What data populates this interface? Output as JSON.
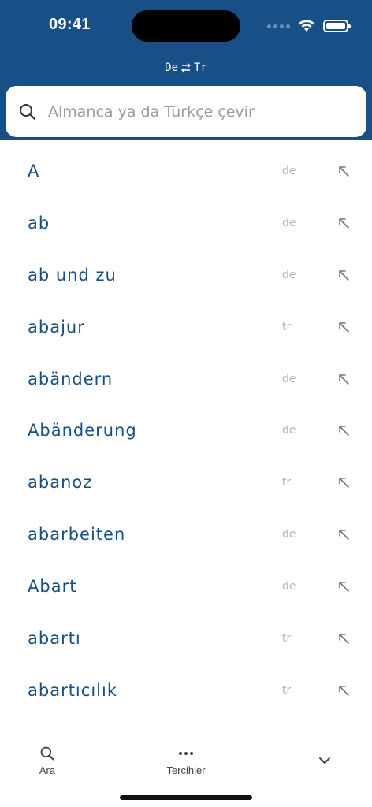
{
  "status": {
    "time": "09:41"
  },
  "header": {
    "lang_left": "De",
    "lang_right": "Tr"
  },
  "search": {
    "placeholder": "Almanca ya da Türkçe çevir",
    "value": ""
  },
  "results": [
    {
      "word": "A",
      "lang": "de"
    },
    {
      "word": "ab",
      "lang": "de"
    },
    {
      "word": "ab und zu",
      "lang": "de"
    },
    {
      "word": "abajur",
      "lang": "tr"
    },
    {
      "word": "abändern",
      "lang": "de"
    },
    {
      "word": "Abänderung",
      "lang": "de"
    },
    {
      "word": "abanoz",
      "lang": "tr"
    },
    {
      "word": "abarbeiten",
      "lang": "de"
    },
    {
      "word": "Abart",
      "lang": "de"
    },
    {
      "word": "abartı",
      "lang": "tr"
    },
    {
      "word": "abartıcılık",
      "lang": "tr"
    }
  ],
  "tabbar": {
    "search_label": "Ara",
    "prefs_label": "Tercihler"
  },
  "colors": {
    "brand": "#184f86",
    "muted": "#b3b3b3"
  }
}
